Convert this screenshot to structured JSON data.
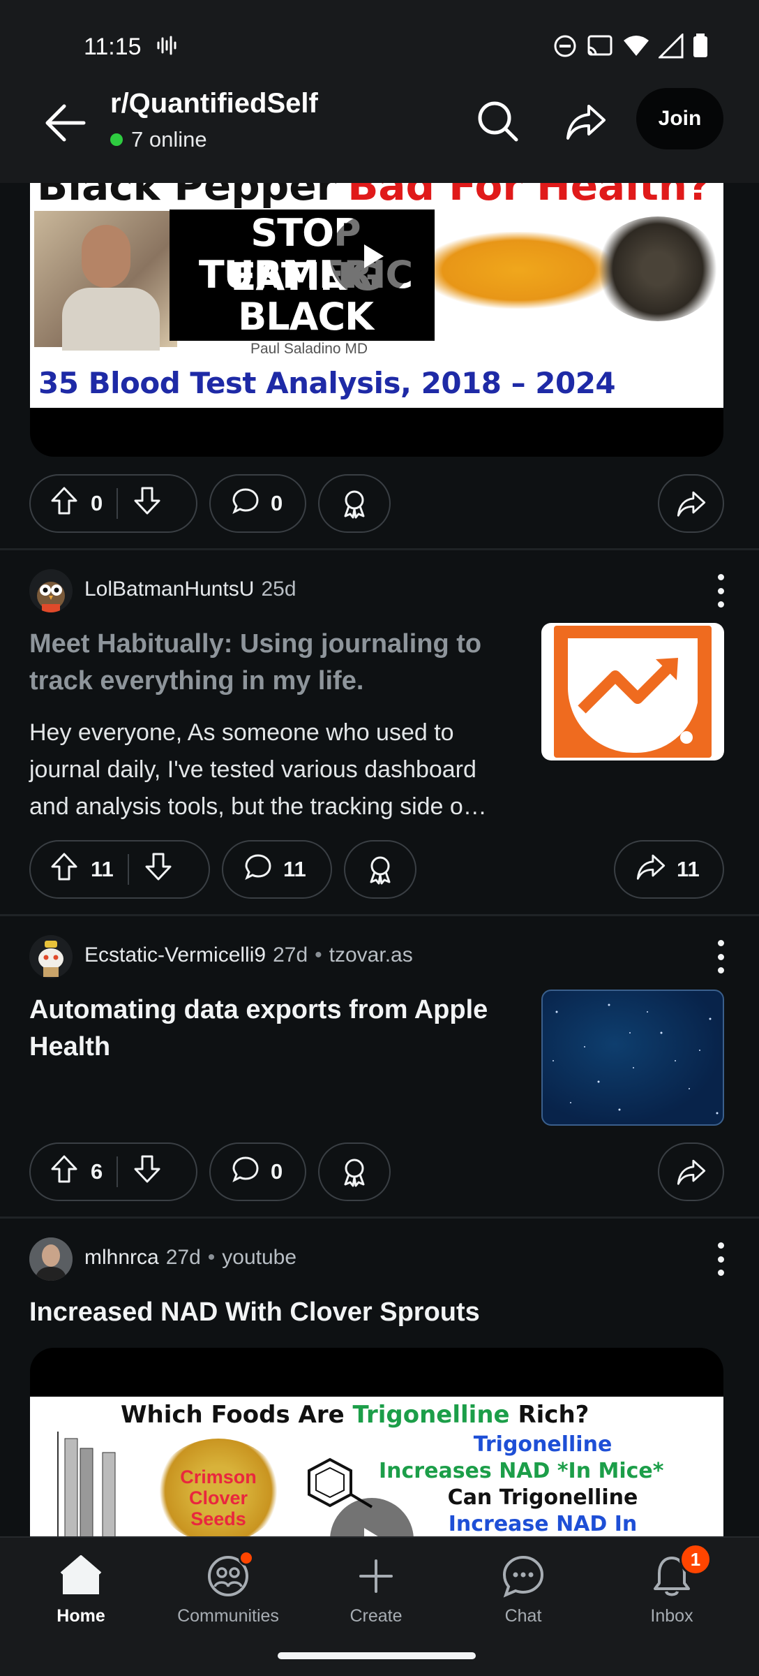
{
  "status_bar": {
    "time": "11:15"
  },
  "header": {
    "subreddit": "r/QuantifiedSelf",
    "online": "7 online",
    "join_label": "Join"
  },
  "post1": {
    "video": {
      "top_text": "Black Pepper",
      "top_text_red": "Bad For Health?",
      "stop_lines": [
        "STOP EATING",
        "TURMERIC",
        "BLACK PEPPER"
      ],
      "credit": "Paul Saladino MD",
      "caption": "35 Blood Test Analysis, 2018 – 2024"
    },
    "upvotes": "0",
    "comments": "0"
  },
  "post2": {
    "author": "LolBatmanHuntsU",
    "age": "25d",
    "title": "Meet Habitually: Using journaling to track everything in my life.",
    "body": "Hey everyone, As someone who used to journal daily, I've tested various dashboard and analysis tools, but the tracking side o…",
    "upvotes": "11",
    "comments": "11",
    "shares": "11"
  },
  "post3": {
    "author": "Ecstatic-Vermicelli9",
    "age": "27d",
    "domain": "tzovar.as",
    "title": "Automating data exports from Apple Health",
    "upvotes": "6",
    "comments": "0"
  },
  "post4": {
    "author": "mlhnrca",
    "age": "27d",
    "domain": "youtube",
    "title": "Increased NAD With Clover Sprouts",
    "video": {
      "q_prefix": "Which Foods Are",
      "q_green": "Trigonelline",
      "q_suffix": "Rich?",
      "seeds_lines": [
        "Crimson",
        "Clover",
        "Seeds"
      ],
      "right_lines": [
        {
          "text": "Trigonelline",
          "color": "#1e4fd6"
        },
        {
          "text": "Increases NAD *In Mice*",
          "color": "#1c9e49"
        },
        {
          "text": "Can Trigonelline",
          "color": "#111111"
        },
        {
          "text": "Increase NAD In",
          "color": "#1e4fd6"
        }
      ]
    }
  },
  "bottom_nav": [
    {
      "label": "Home",
      "icon": "home-icon",
      "active": true
    },
    {
      "label": "Communities",
      "icon": "communities-icon",
      "active": false
    },
    {
      "label": "Create",
      "icon": "plus-icon",
      "active": false
    },
    {
      "label": "Chat",
      "icon": "chat-icon",
      "active": false
    },
    {
      "label": "Inbox",
      "icon": "bell-icon",
      "active": false,
      "badge": "1"
    }
  ],
  "colors": {
    "accent": "#ff4500",
    "online": "#2ecc40",
    "background": "#0e1113"
  }
}
